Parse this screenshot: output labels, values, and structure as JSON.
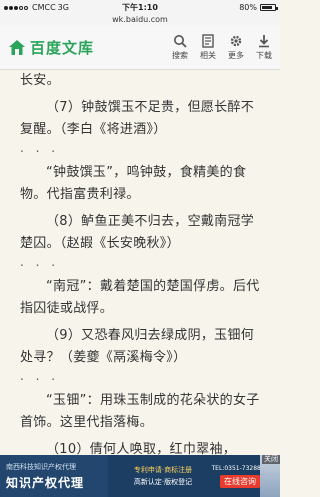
{
  "status_bar": {
    "carrier": "CMCC",
    "network": "3G",
    "time": "下午1:10",
    "battery_percent": "80%",
    "battery_level": 0.8
  },
  "url_bar": {
    "url": "wk.baidu.com"
  },
  "header": {
    "logo_text": "百度文库",
    "tools": [
      {
        "label": "搜索",
        "icon": "search-icon"
      },
      {
        "label": "相关",
        "icon": "related-icon"
      },
      {
        "label": "更多",
        "icon": "gear-icon"
      },
      {
        "label": "下载",
        "icon": "download-icon"
      }
    ]
  },
  "article": {
    "lines": [
      "长安。",
      "（7）钟鼓馔玉不足贵，但愿长醉不复醒。（李白《将进酒》）",
      "“钟鼓馔玉”，鸣钟鼓，食精美的食物。代指富贵利禄。",
      "（8）鲈鱼正美不归去，空戴南冠学楚囚。（赵嘏《长安晚秋》）",
      "“南冠”：戴着楚国的楚国俘虏。后代指囚徒或战俘。",
      "（9）又恐春风归去绿成阴，玉钿何处寻？（姜夔《鬲溪梅令》）",
      "“玉钿”：用珠玉制成的花朵状的女子首饰。这里代指落梅。",
      "（10）倩何人唤取，红巾翠袖，"
    ],
    "ellipsis": ". . ."
  },
  "ad": {
    "org": "南西科技知识产权代理",
    "title": "知识产权代理",
    "line1": "专利申请·商标注册",
    "line2": "高新认定·版权登记",
    "phone": "TEL:0351-7328877",
    "consult": "在线咨询",
    "close": "关闭"
  },
  "colors": {
    "brand_green": "#2aa45a",
    "ad_bg": "#1c3e63",
    "ad_button": "#e93b2e"
  }
}
